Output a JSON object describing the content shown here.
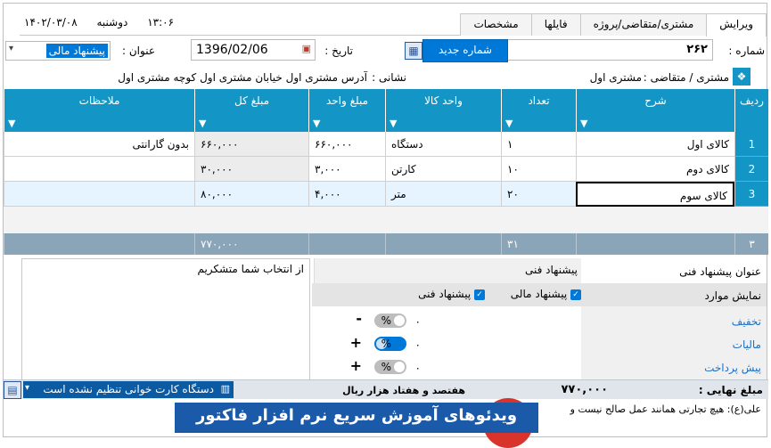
{
  "clock": {
    "time": "۱۳:۰۶",
    "day": "دوشنبه",
    "date": "۱۴۰۲/۰۳/۰۸"
  },
  "tabs": [
    "ویرایش",
    "مشتری/متقاضی/پروژه",
    "فایلها",
    "مشخصات"
  ],
  "header": {
    "number_label": "شماره :",
    "number_value": "۲۶۲",
    "new_number_button": "شماره جدید",
    "date_label": "تاریخ :",
    "date_value": "1396/02/06",
    "title_label": "عنوان :",
    "title_value": "پیشنهاد مالی",
    "customer_label": "مشتری / متقاضی :",
    "customer_value": "مشتری اول",
    "address_label": "نشانی :",
    "address_value": "آدرس مشتری اول خیابان مشتری اول کوچه مشتری اول"
  },
  "grid": {
    "columns": [
      "ردیف",
      "شرح",
      "تعداد",
      "واحد کالا",
      "مبلغ واحد",
      "مبلغ کل",
      "ملاحظات"
    ],
    "rows": [
      {
        "idx": "1",
        "desc": "کالای اول",
        "qty": "۱",
        "unit": "دستگاه",
        "unit_price": "۶۶۰,۰۰۰",
        "total": "۶۶۰,۰۰۰",
        "note": "بدون گارانتی"
      },
      {
        "idx": "2",
        "desc": "کالای دوم",
        "qty": "۱۰",
        "unit": "کارتن",
        "unit_price": "۳,۰۰۰",
        "total": "۳۰,۰۰۰",
        "note": ""
      },
      {
        "idx": "3",
        "desc": "کالای سوم",
        "qty": "۲۰",
        "unit": "متر",
        "unit_price": "۴,۰۰۰",
        "total": "۸۰,۰۰۰",
        "note": ""
      }
    ],
    "footer": {
      "count": "۳",
      "qty_total": "۳۱",
      "total": "۷۷۰,۰۰۰"
    }
  },
  "bottom": {
    "notes_text": "از انتخاب شما متشکریم",
    "tech_title_label": "عنوان پیشنهاد فنی",
    "tech_title_value": "پیشنهاد فنی",
    "show_items_label": "نمایش موارد",
    "check_financial": "پیشنهاد مالی",
    "check_technical": "پیشنهاد فنی",
    "discount_label": "تخفیف",
    "tax_label": "مالیات",
    "prepay_label": "پیش پرداخت",
    "discount_value": "۰",
    "tax_value": "۰",
    "prepay_value": "۰",
    "pct": "%",
    "minus": "-",
    "plus": "+",
    "final_label": "مبلغ نهایی :",
    "final_value": "۷۷۰,۰۰۰",
    "final_words": "هفتصد و هفتاد  هزار  ریال",
    "card_reader": "دستگاه کارت خوانی تنظیم نشده است",
    "quote": "علی(ع): هیچ تجارتی همانند عمل صالح نیست و",
    "banner": "ویدئوهای آموزش سریع نرم افزار فاکتور"
  },
  "colors": {
    "header_blue": "#1396c6",
    "accent": "#0078d7",
    "footer_gray": "#8aa4b8"
  }
}
